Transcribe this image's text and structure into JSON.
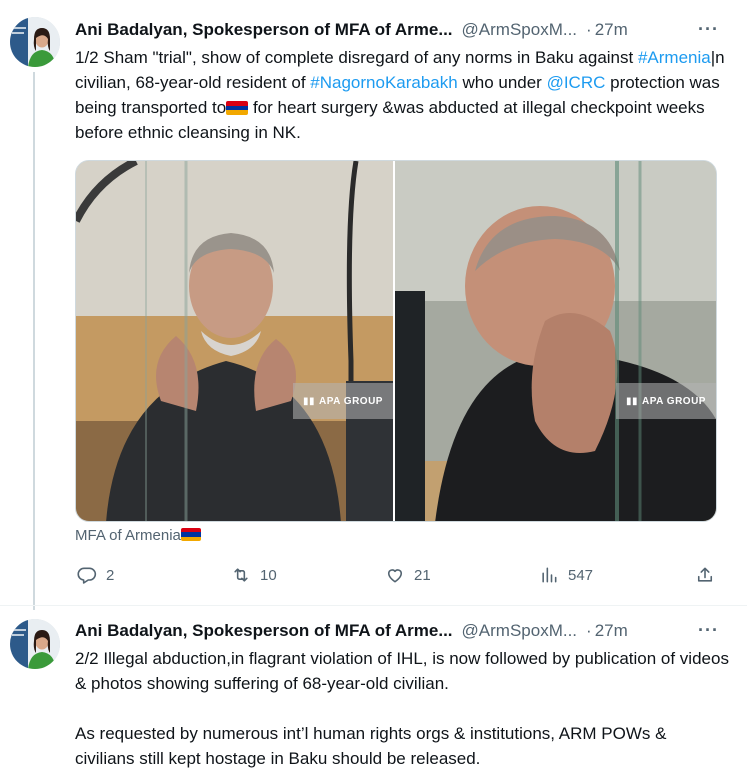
{
  "tweets": [
    {
      "author": "Ani Badalyan, Spokesperson of MFA of Arme...",
      "handle": "@ArmSpoxM...",
      "time": "27m",
      "text": {
        "p1": "1/2 Sham \"trial\", show of complete disregard of any norms in Baku against ",
        "tag1": "#Armenia",
        "p2": "|n civilian, 68-year-old resident of ",
        "tag2": "#NagornoKarabakh",
        "p3": " who under ",
        "mention": "@ICRC",
        "p4": " protection was being transported to",
        "p5": " for heart surgery &was abducted at illegal checkpoint weeks before ethnic cleansing in NK."
      },
      "media": [
        {
          "watermark": "APA GROUP",
          "icon": "apa-logo-icon"
        },
        {
          "watermark": "APA GROUP",
          "icon": "apa-logo-icon"
        }
      ],
      "source": "MFA of Armenia",
      "stats": {
        "replies": "2",
        "retweets": "10",
        "likes": "21",
        "views": "547"
      }
    },
    {
      "author": "Ani Badalyan, Spokesperson of MFA of Arme...",
      "handle": "@ArmSpoxM...",
      "time": "27m",
      "text": {
        "p1": "2/2 Illegal abduction,in flagrant violation of IHL, is now followed by publication of videos & photos showing suffering of 68-year-old civilian.",
        "p2": "As requested by numerous int’l human rights orgs & institutions, ARM POWs & civilians still kept hostage in Baku should be released."
      }
    }
  ],
  "colors": {
    "link": "#1d9bf0",
    "muted": "#536471",
    "flag_red": "#d90012",
    "flag_blue": "#0033a0",
    "flag_orange": "#f2a800"
  }
}
